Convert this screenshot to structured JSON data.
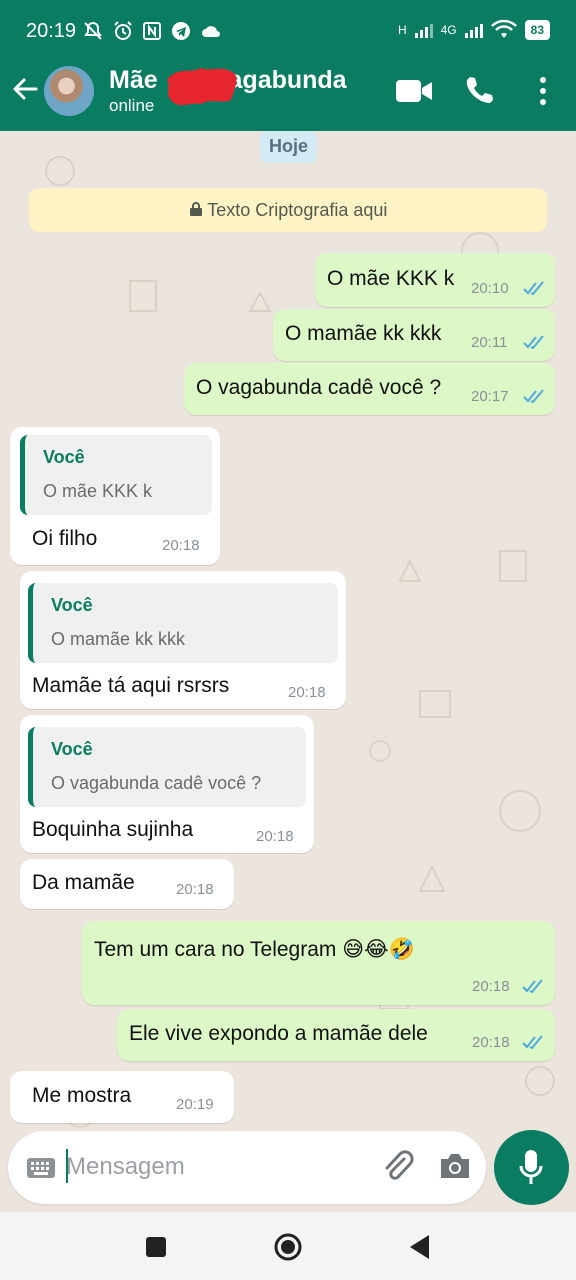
{
  "status_bar": {
    "time": "20:19",
    "network_labels": [
      "H",
      "4G"
    ],
    "battery": "83",
    "icons": [
      "mute-icon",
      "alarm-icon",
      "nfc-icon",
      "telegram-icon",
      "cloud-icon",
      "signal-icon",
      "wifi-icon",
      "battery-icon"
    ]
  },
  "header": {
    "name_first": "Mãe",
    "name_last": "Vagabunda",
    "status": "online",
    "accent_color": "#0a7c62",
    "icons": [
      "back-arrow-icon",
      "video-call-icon",
      "phone-icon",
      "more-vert-icon"
    ]
  },
  "chat": {
    "day_label": "Hoje",
    "encryption_notice": "Texto Criptografia aqui",
    "messages": [
      {
        "dir": "out",
        "text": "O mãe KKK k",
        "time": "20:10",
        "read": true
      },
      {
        "dir": "out",
        "text": "O mamãe kk kkk",
        "time": "20:11",
        "read": true
      },
      {
        "dir": "out",
        "text": "O vagabunda cadê você ?",
        "time": "20:17",
        "read": true
      },
      {
        "dir": "in",
        "quote_author": "Você",
        "quote_text": "O mãe KKK k",
        "text": "Oi filho",
        "time": "20:18"
      },
      {
        "dir": "in",
        "quote_author": "Você",
        "quote_text": "O mamãe kk kkk",
        "text": "Mamãe tá aqui rsrsrs",
        "time": "20:18"
      },
      {
        "dir": "in",
        "quote_author": "Você",
        "quote_text": "O vagabunda cadê você ?",
        "text": "Boquinha sujinha",
        "time": "20:18"
      },
      {
        "dir": "in",
        "text": "Da mamãe",
        "time": "20:18"
      },
      {
        "dir": "out",
        "text": "Tem um cara no Telegram 😅😂🤣",
        "time": "20:18",
        "read": true
      },
      {
        "dir": "out",
        "text": "Ele vive expondo a mamãe dele",
        "time": "20:18",
        "read": true
      },
      {
        "dir": "in",
        "text": "Me mostra",
        "time": "20:19"
      }
    ]
  },
  "composer": {
    "placeholder": "Mensagem",
    "icons": [
      "keyboard-icon",
      "attach-icon",
      "camera-icon",
      "mic-icon"
    ]
  },
  "colors": {
    "outgoing_bubble": "#dcf8c6",
    "incoming_bubble": "#ffffff",
    "read_ticks": "#4fa8e0",
    "chat_bg": "#ece5dd"
  }
}
